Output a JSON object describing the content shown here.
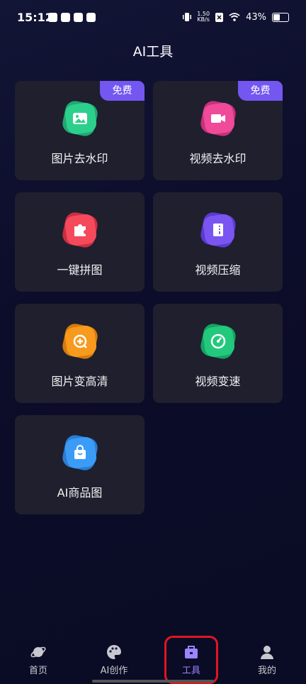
{
  "status_bar": {
    "time": "15:12",
    "net_speed_value": "1.50",
    "net_speed_unit": "KB/s",
    "battery": "43%"
  },
  "page_title": "AI工具",
  "tools": [
    {
      "label": "图片去水印",
      "badge": "免费",
      "icon": "image-icon",
      "color": "#2dcf8c"
    },
    {
      "label": "视频去水印",
      "badge": "免费",
      "icon": "video-camera-icon",
      "color": "#f04a9b"
    },
    {
      "label": "一键拼图",
      "badge": "",
      "icon": "puzzle-icon",
      "color": "#f44a5c"
    },
    {
      "label": "视频压缩",
      "badge": "",
      "icon": "compress-icon",
      "color": "#7a55f2"
    },
    {
      "label": "图片变高清",
      "badge": "",
      "icon": "enhance-icon",
      "color": "#f79a1d"
    },
    {
      "label": "视频变速",
      "badge": "",
      "icon": "speed-gauge-icon",
      "color": "#22c97c"
    },
    {
      "label": "AI商品图",
      "badge": "",
      "icon": "shopping-bag-icon",
      "color": "#3b9cf7"
    }
  ],
  "tabbar": {
    "items": [
      {
        "label": "首页",
        "icon": "planet-icon"
      },
      {
        "label": "AI创作",
        "icon": "palette-icon"
      },
      {
        "label": "工具",
        "icon": "toolbox-icon",
        "active": true
      },
      {
        "label": "我的",
        "icon": "user-icon"
      }
    ],
    "active_color": "#9c83ff"
  }
}
